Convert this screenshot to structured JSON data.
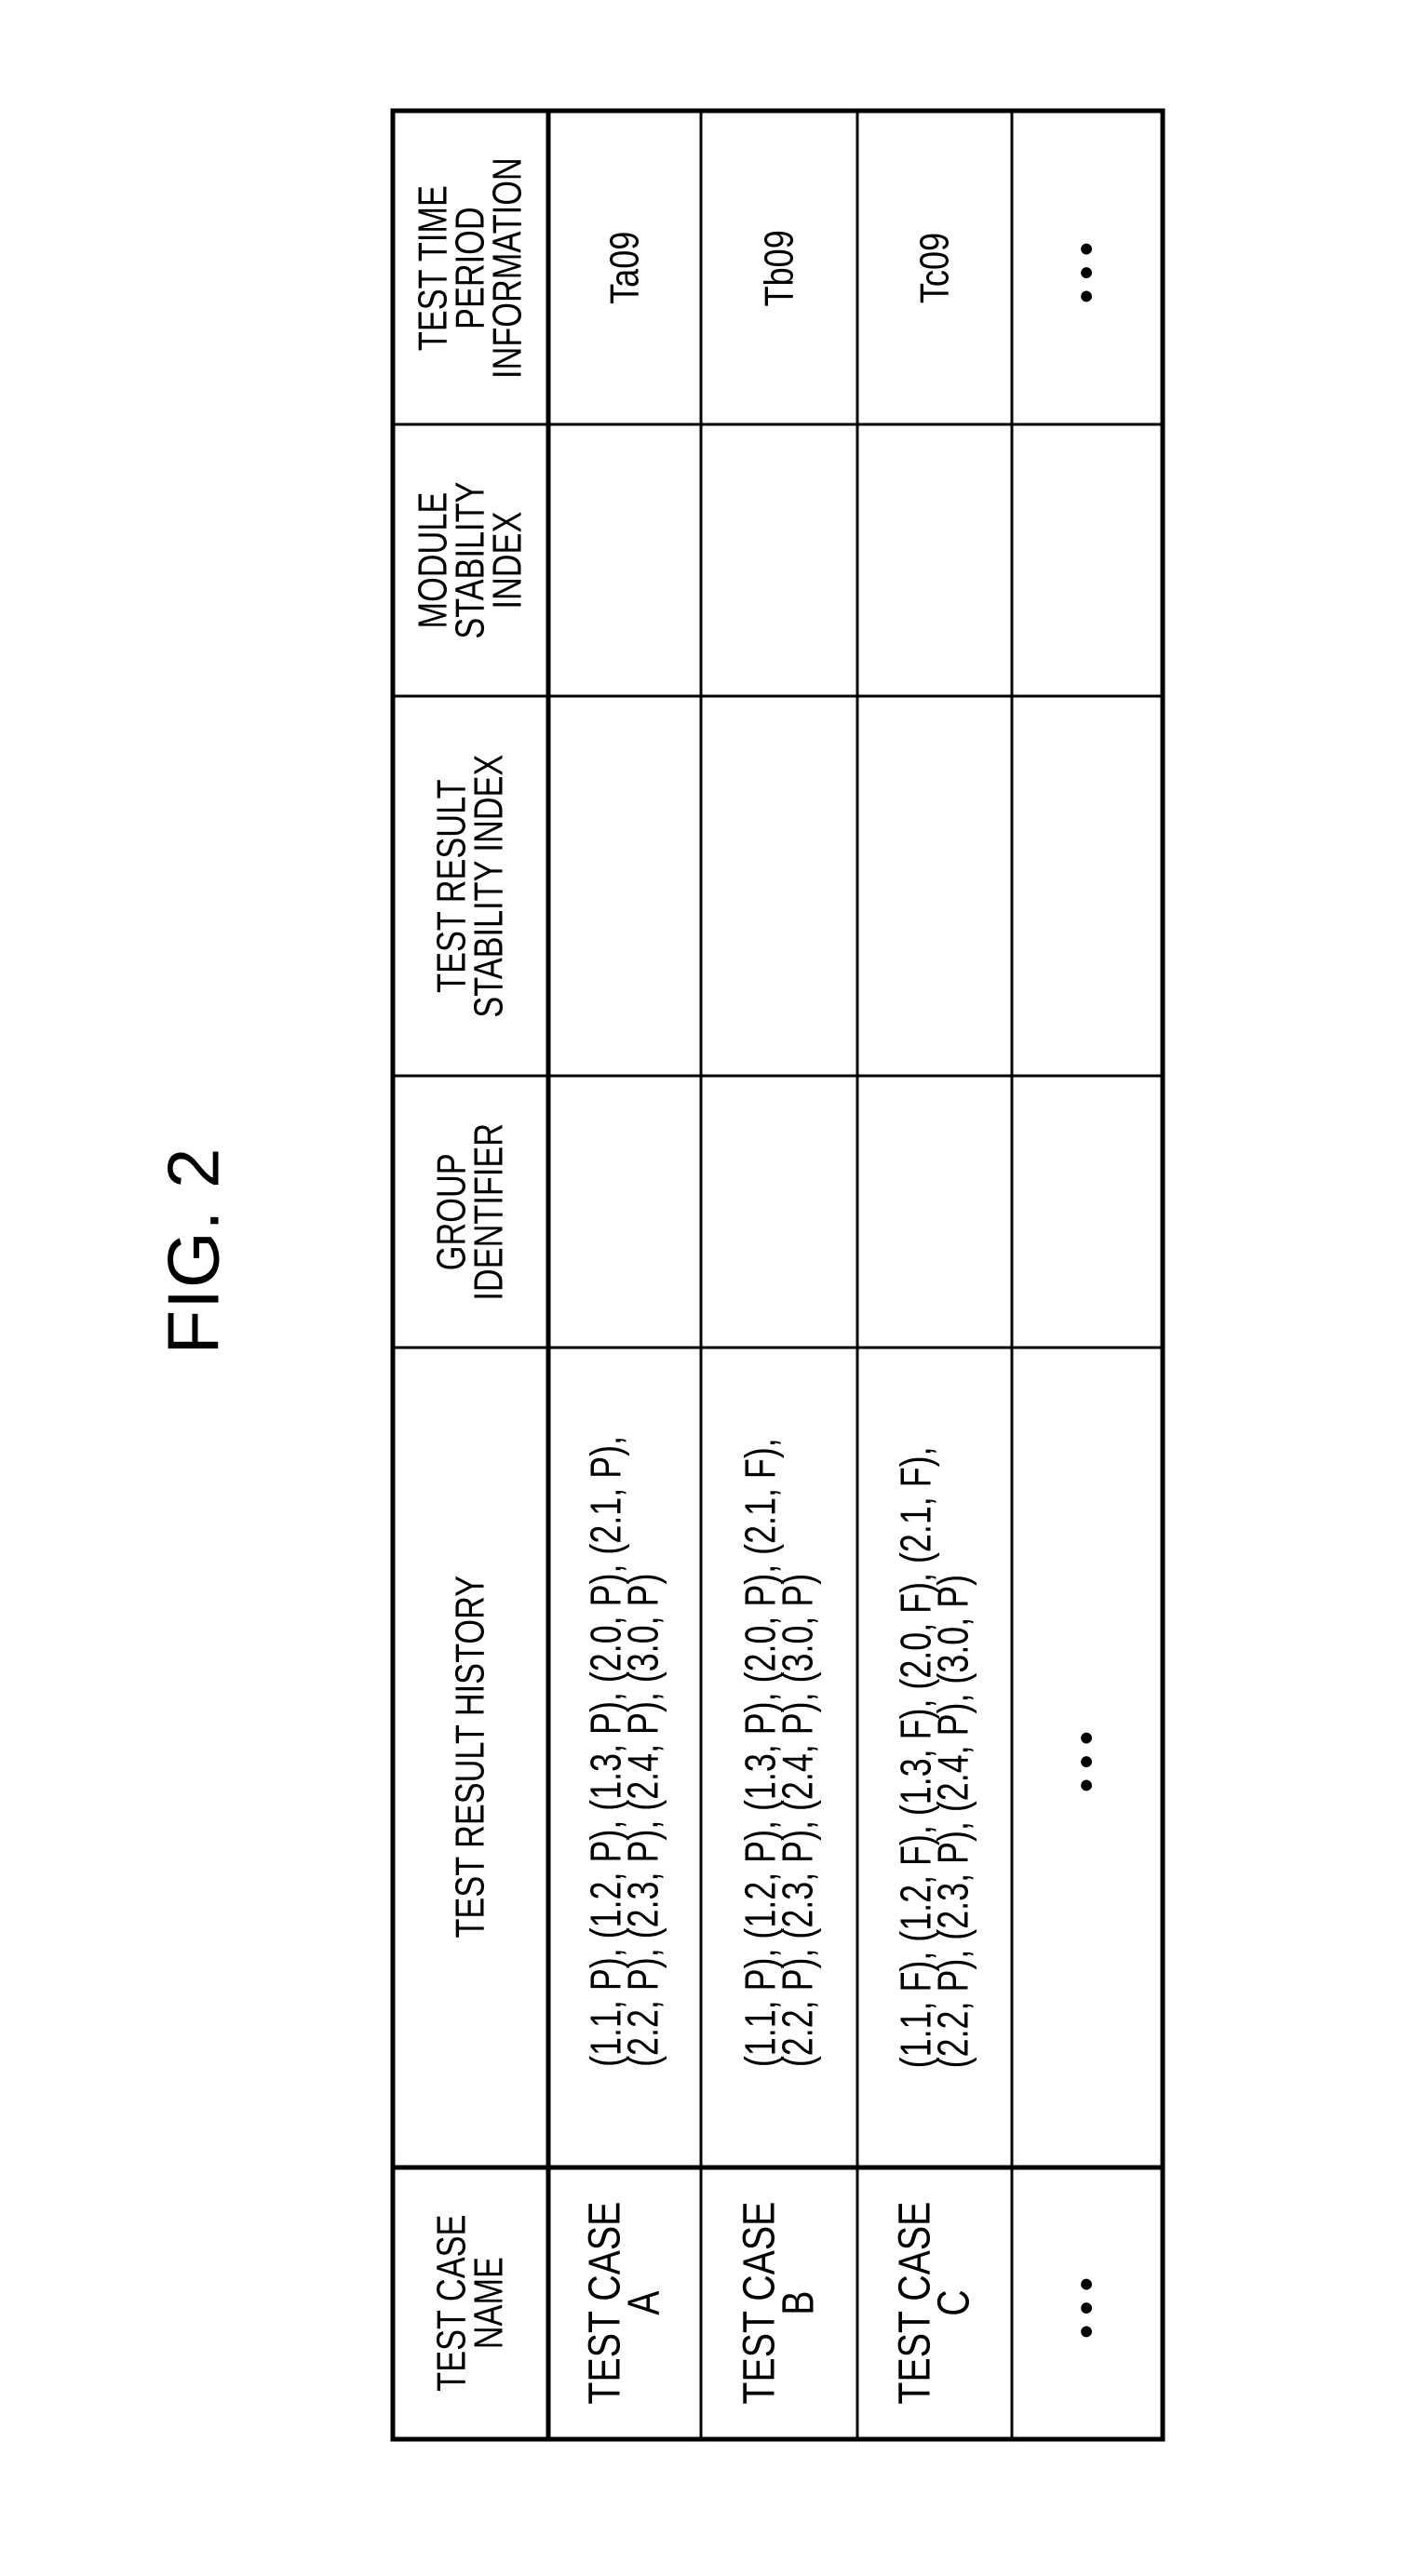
{
  "figure": {
    "label": "FIG. 2"
  },
  "table": {
    "headers": {
      "test_case_name": "TEST CASE\nNAME",
      "test_result_history": "TEST RESULT HISTORY",
      "group_identifier": "GROUP\nIDENTIFIER",
      "test_result_stability_index": "TEST RESULT\nSTABILITY INDEX",
      "module_stability_index": "MODULE\nSTABILITY\nINDEX",
      "test_time_period_information": "TEST TIME\nPERIOD\nINFORMATION"
    },
    "rows": [
      {
        "test_case_name": "TEST CASE\nA",
        "history_line1": "(1.1, P), (1.2, P), (1.3, P), (2.0, P), (2.1, P),",
        "history_line2": "(2.2, P), (2.3, P), (2.4, P), (3.0, P)",
        "group_identifier": "",
        "test_result_stability_index": "",
        "module_stability_index": "",
        "test_time_period_information": "Ta09"
      },
      {
        "test_case_name": "TEST CASE\nB",
        "history_line1": "(1.1, P), (1.2, P), (1.3, P), (2.0, P), (2.1, F),",
        "history_line2": "(2.2, P), (2.3, P), (2.4, P), (3.0, P)",
        "group_identifier": "",
        "test_result_stability_index": "",
        "module_stability_index": "",
        "test_time_period_information": "Tb09"
      },
      {
        "test_case_name": "TEST CASE\nC",
        "history_line1": "(1.1, F), (1.2, F), (1.3, F), (2.0, F), (2.1, F),",
        "history_line2": "(2.2, P), (2.3, P), (2.4, P), (3.0, P)",
        "group_identifier": "",
        "test_result_stability_index": "",
        "module_stability_index": "",
        "test_time_period_information": "Tc09"
      }
    ],
    "continuation_row": {
      "test_case_name": "•••",
      "test_result_history": "•••",
      "test_time_period_information": "•••"
    }
  }
}
